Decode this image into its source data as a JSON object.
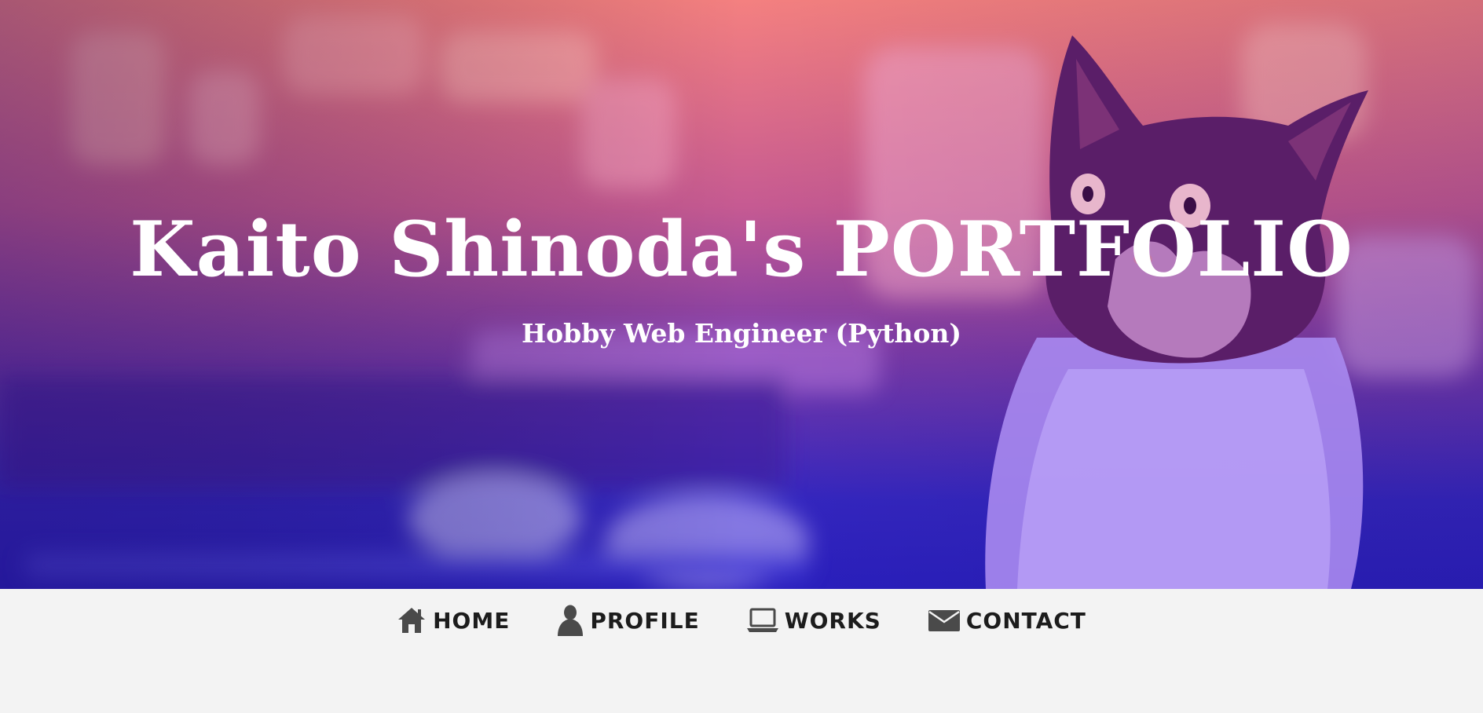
{
  "hero": {
    "title": "Kaito Shinoda's PORTFOLIO",
    "subtitle": "Hobby Web Engineer (Python)",
    "background_image": "cat-photo",
    "gradient_colors": [
      "#f47a7a",
      "#9b3fa0",
      "#2b1fb8"
    ]
  },
  "nav": {
    "items": [
      {
        "label": "HOME",
        "icon": "home-icon"
      },
      {
        "label": "PROFILE",
        "icon": "person-icon"
      },
      {
        "label": "WORKS",
        "icon": "laptop-icon"
      },
      {
        "label": "CONTACT",
        "icon": "envelope-icon"
      }
    ]
  },
  "colors": {
    "nav_background": "#f3f3f3",
    "nav_text": "#1c1c1c",
    "icon": "#4a4a4a"
  }
}
